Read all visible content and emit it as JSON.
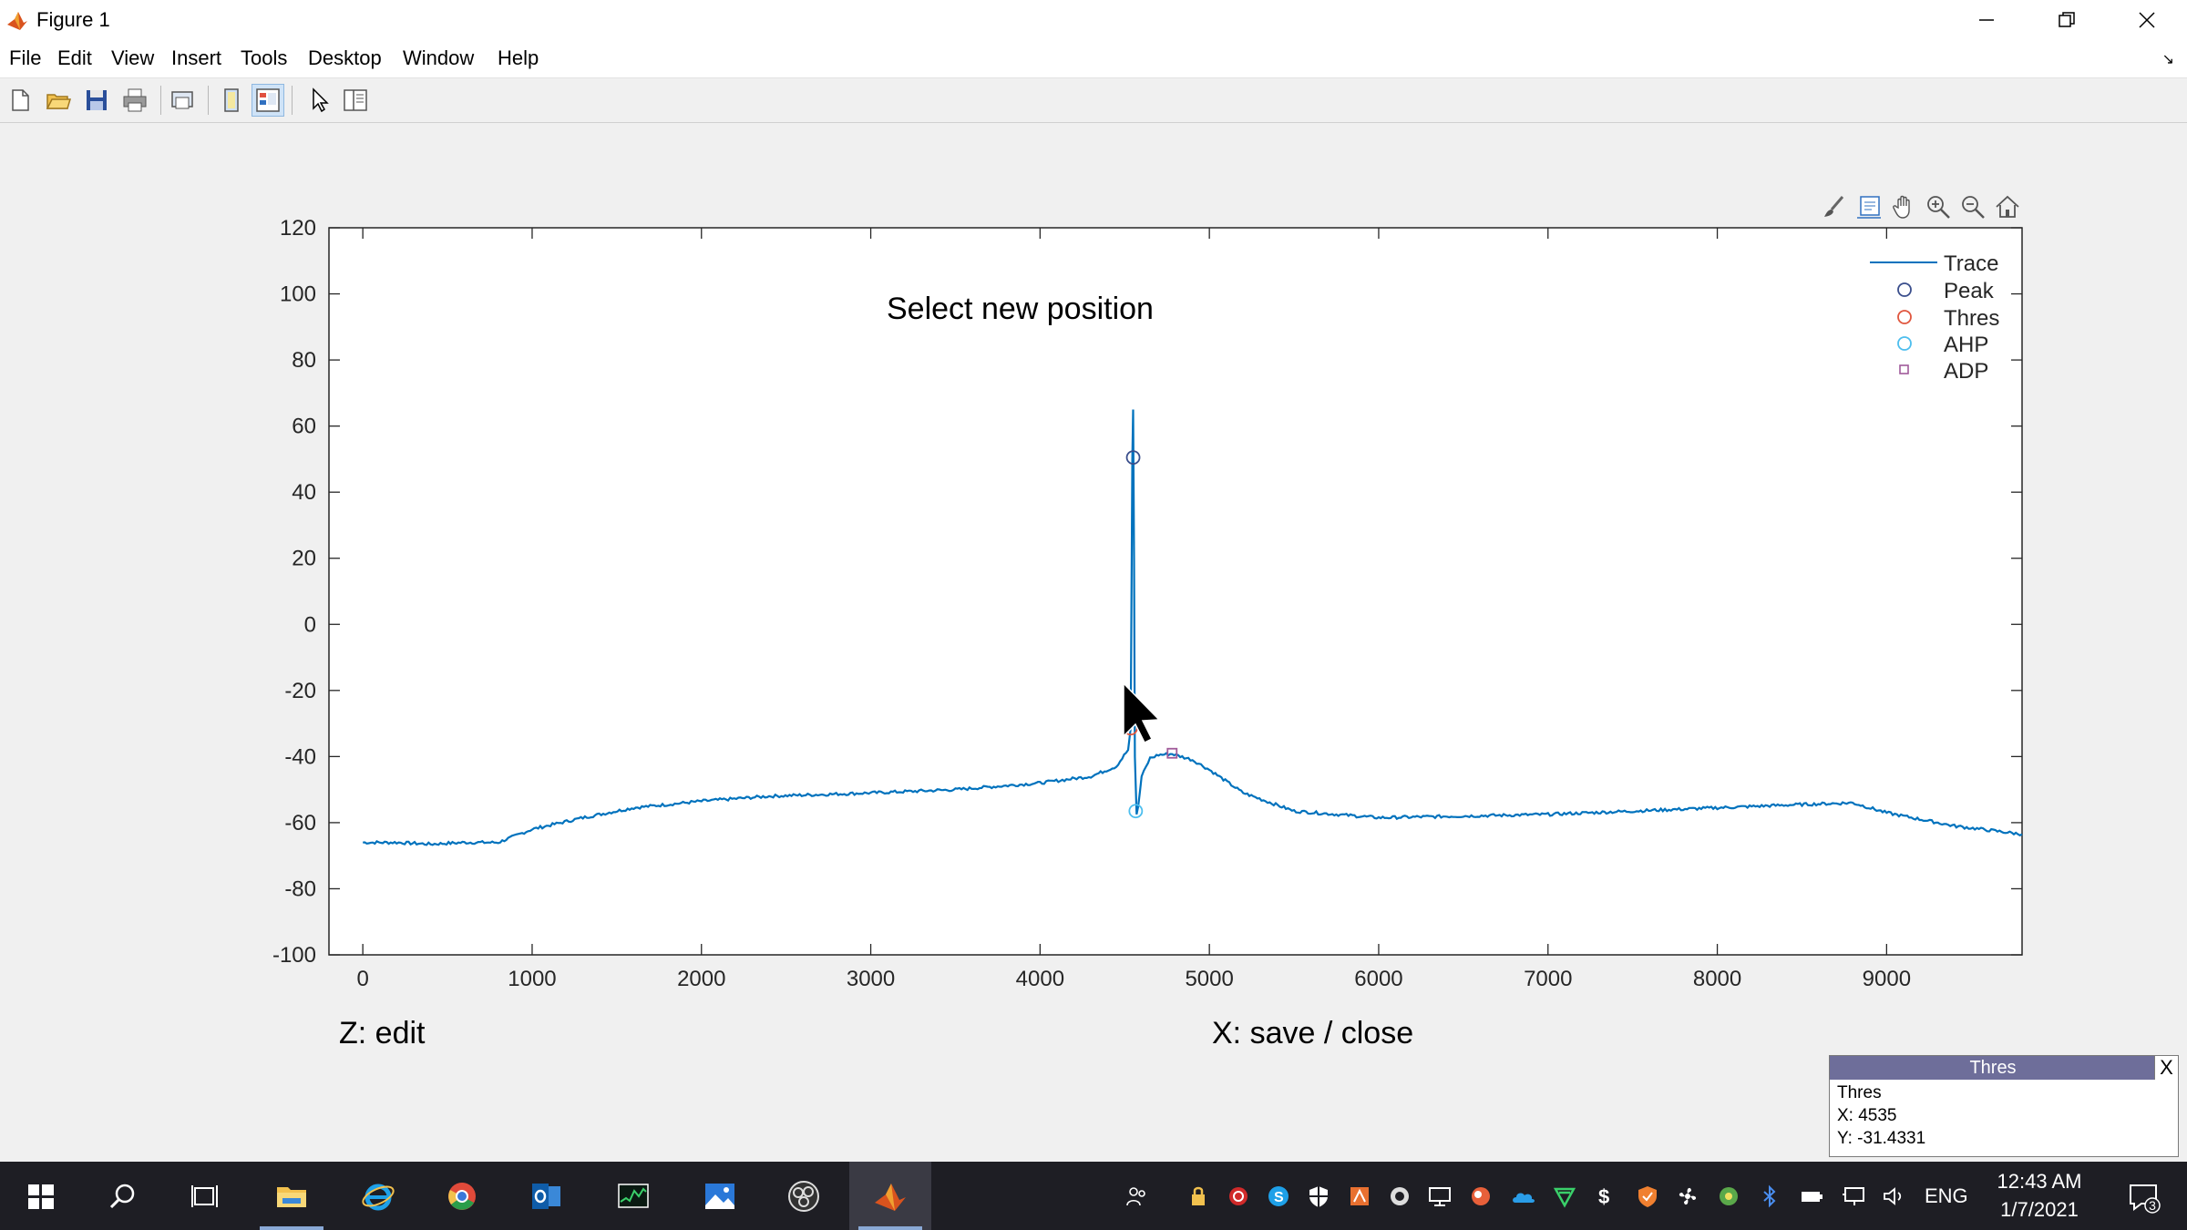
{
  "window": {
    "title": "Figure 1"
  },
  "menu": [
    "File",
    "Edit",
    "View",
    "Insert",
    "Tools",
    "Desktop",
    "Window",
    "Help"
  ],
  "toolbar_icons": [
    "new-figure-icon",
    "open-file-icon",
    "save-icon",
    "print-icon",
    "print-preview-icon",
    "hide-plot-tools-icon",
    "show-plot-tools-icon",
    "pointer-icon",
    "dock-layout-icon"
  ],
  "axes_toolbar_icons": [
    "brush-icon",
    "datatip-icon",
    "pan-icon",
    "zoom-in-icon",
    "zoom-out-icon",
    "home-icon"
  ],
  "figure": {
    "annotation": "Select new position",
    "left_prompt": "Z: edit",
    "right_prompt": "X: save / close"
  },
  "chart_data": {
    "type": "line",
    "x_range": [
      -200,
      9800
    ],
    "y_range": [
      -100,
      120
    ],
    "x_ticks": [
      0,
      1000,
      2000,
      3000,
      4000,
      5000,
      6000,
      7000,
      8000,
      9000
    ],
    "y_ticks": [
      -100,
      -80,
      -60,
      -40,
      -20,
      0,
      20,
      40,
      60,
      80,
      100,
      120
    ],
    "legend_position": "top-right",
    "series": [
      {
        "name": "Trace",
        "color": "#0072bd",
        "marker": "line",
        "x": [
          0,
          200,
          400,
          600,
          800,
          1000,
          1300,
          1600,
          2000,
          2400,
          3000,
          3500,
          4000,
          4300,
          4450,
          4520,
          4535,
          4545,
          4550,
          4555,
          4560,
          4570,
          4580,
          4600,
          4650,
          4700,
          4780,
          4900,
          5000,
          5200,
          5500,
          6000,
          6500,
          7000,
          7500,
          8000,
          8500,
          8800,
          9000,
          9400,
          9800
        ],
        "y": [
          -66,
          -66,
          -66.5,
          -66,
          -66,
          -62,
          -58.5,
          -55.5,
          -53.5,
          -52,
          -51,
          -50,
          -48,
          -46,
          -43,
          -38,
          -31.4,
          50,
          65,
          20,
          -40,
          -57.5,
          -55,
          -46,
          -40.5,
          -39.5,
          -39.2,
          -41,
          -44,
          -51,
          -56.5,
          -58.5,
          -58,
          -57.5,
          -56.5,
          -55.5,
          -54.5,
          -54,
          -57,
          -61,
          -63.5
        ]
      },
      {
        "name": "Peak",
        "color": "#3a4e8c",
        "marker": "circle",
        "x": [
          4550
        ],
        "y": [
          50.5
        ]
      },
      {
        "name": "Thres",
        "color": "#e0563e",
        "marker": "circle",
        "x": [
          4535
        ],
        "y": [
          -31.4331
        ]
      },
      {
        "name": "AHP",
        "color": "#4dbeee",
        "marker": "circle",
        "x": [
          4565
        ],
        "y": [
          -56.5
        ]
      },
      {
        "name": "ADP",
        "color": "#a05a9a",
        "marker": "square",
        "x": [
          4780
        ],
        "y": [
          -39
        ]
      }
    ]
  },
  "datatip": {
    "header": "Thres",
    "close_label": "X",
    "series": "Thres",
    "x_text": "X: 4535",
    "y_text": "Y: -31.4331"
  },
  "taskbar": {
    "apps": [
      "windows-start-icon",
      "search-icon",
      "task-view-icon",
      "file-explorer-icon",
      "internet-explorer-icon",
      "chrome-icon",
      "outlook-icon",
      "system-monitor-icon",
      "photos-icon",
      "obs-icon",
      "matlab-icon"
    ],
    "tray_icons": [
      "people-icon",
      "lock-icon",
      "sync-icon",
      "skype-icon",
      "shield-icon",
      "office-icon",
      "network-icon",
      "display-icon",
      "cloud-drive-icon",
      "onedrive-icon",
      "vpn-icon",
      "stocks-icon",
      "antivirus-icon",
      "fan-icon",
      "green-app-icon",
      "bluetooth-icon",
      "battery-icon",
      "monitor-icon",
      "volume-icon"
    ],
    "language": "ENG",
    "time": "12:43 AM",
    "date": "1/7/2021",
    "notifications_count": "3"
  }
}
